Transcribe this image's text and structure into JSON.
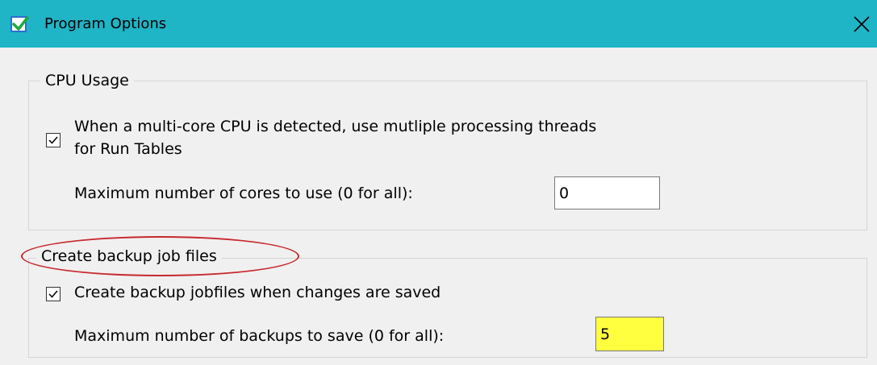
{
  "window": {
    "title": "Program Options",
    "close_symbol": "close-icon"
  },
  "colors": {
    "titlebar": "#1fb4c6",
    "highlight_input": "#ffff40",
    "annotation_ellipse": "#c8282d",
    "window_bg": "#f0f0f0"
  },
  "cpu_group": {
    "legend": "CPU Usage",
    "multicore_checkbox": {
      "checked": true,
      "label_line1": "When a multi-core CPU is detected, use mutliple processing threads",
      "label_line2": "for Run Tables"
    },
    "max_cores": {
      "label": "Maximum number of cores to use (0 for all):",
      "value": "0"
    }
  },
  "backup_group": {
    "legend": "Create backup job files",
    "backup_checkbox": {
      "checked": true,
      "label": "Create backup jobfiles when changes are saved"
    },
    "max_backups": {
      "label": "Maximum number of backups to save (0 for all):",
      "value": "5"
    }
  }
}
